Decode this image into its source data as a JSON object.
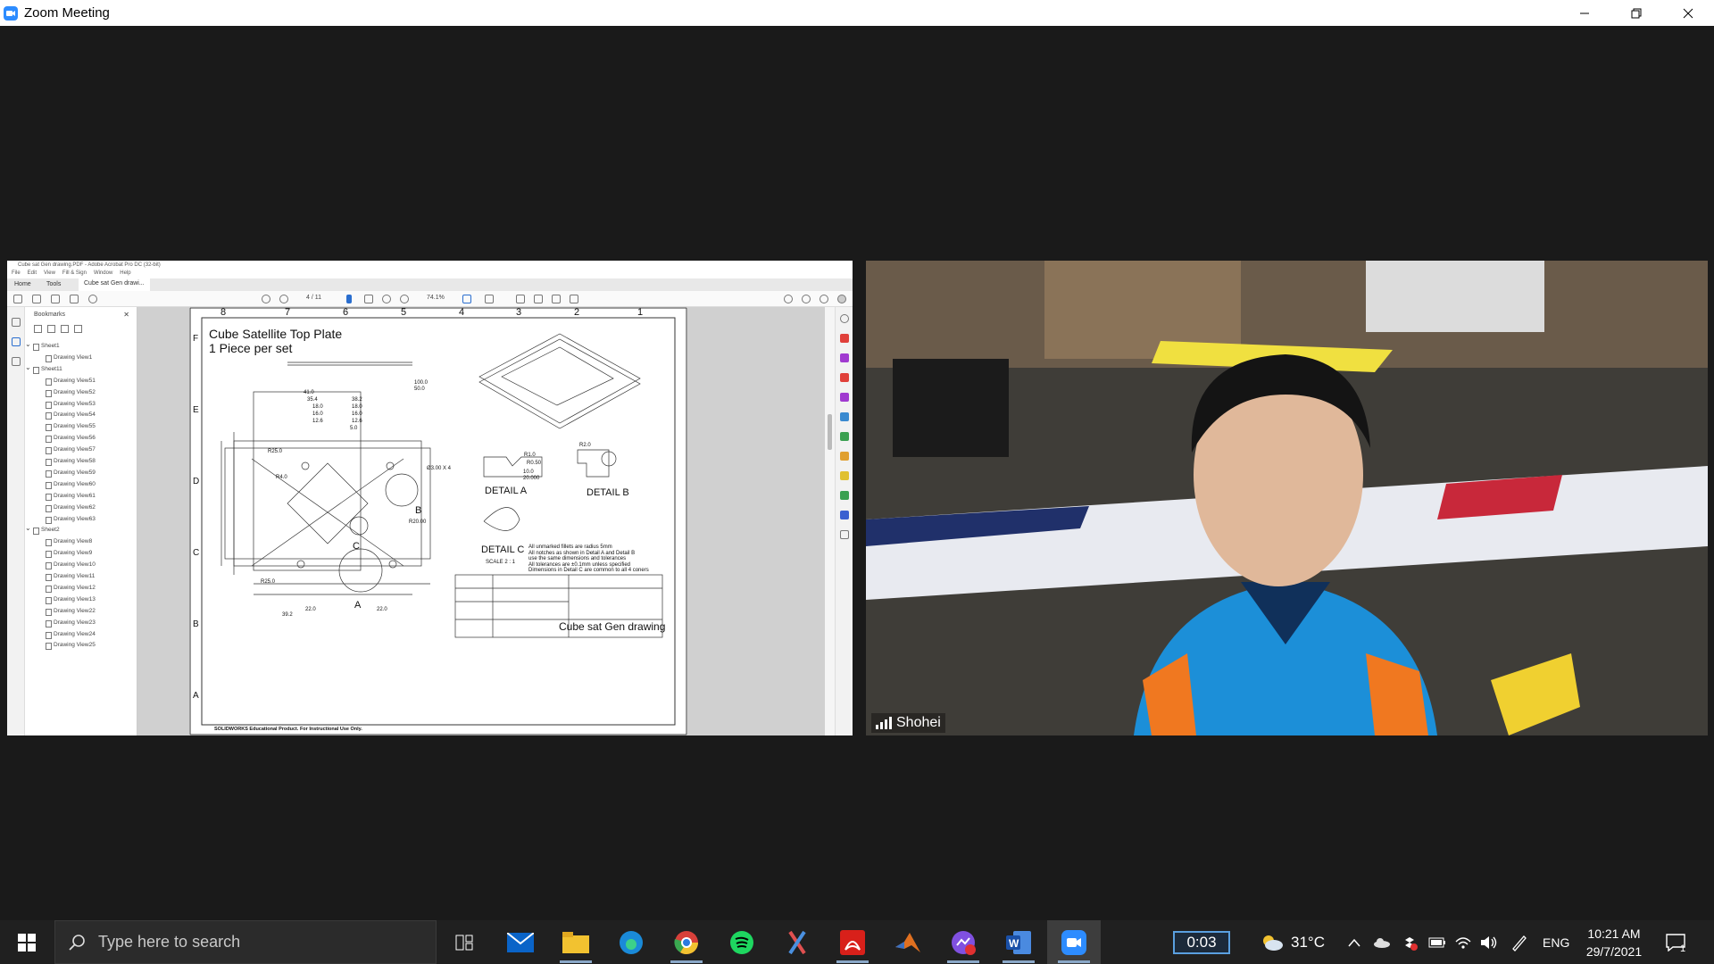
{
  "window": {
    "title": "Zoom Meeting"
  },
  "shared_screen": {
    "app_title": "Cube sat Gen drawing.PDF - Adobe Acrobat Pro DC (32-bit)",
    "menu": [
      "File",
      "Edit",
      "View",
      "Fill & Sign",
      "Window",
      "Help"
    ],
    "tabs": [
      "Home",
      "Tools",
      "Cube sat Gen drawi..."
    ],
    "page_indicator": "4 / 11",
    "zoom_level": "74.1%",
    "bookmarks_title": "Bookmarks",
    "bookmarks": [
      "Sheet1",
      "Drawing View1",
      "Sheet11",
      "Drawing View51",
      "Drawing View52",
      "Drawing View53",
      "Drawing View54",
      "Drawing View55",
      "Drawing View56",
      "Drawing View57",
      "Drawing View58",
      "Drawing View59",
      "Drawing View60",
      "Drawing View61",
      "Drawing View62",
      "Drawing View63",
      "Sheet2",
      "Drawing View8",
      "Drawing View9",
      "Drawing View10",
      "Drawing View11",
      "Drawing View12",
      "Drawing View13",
      "Drawing View22",
      "Drawing View23",
      "Drawing View24",
      "Drawing View25"
    ],
    "drawing": {
      "title": "Cube Satellite Top Plate",
      "subtitle": "1 Piece per set",
      "col_labels": [
        "8",
        "7",
        "6",
        "5",
        "4",
        "3",
        "2",
        "1"
      ],
      "row_labels": [
        "F",
        "E",
        "D",
        "C",
        "B",
        "A"
      ],
      "detail_a": "DETAIL A",
      "detail_b": "DETAIL B",
      "detail_c": "DETAIL C",
      "scale": "SCALE 2 : 1",
      "label_a": "A",
      "label_b": "B",
      "label_c": "C",
      "notes": [
        "All unmarked fillets are radius 5mm",
        "All notches as shown in Detail A and Detail B",
        "use the same dimensions and tolerances",
        "All tolerances are ±0.1mm unless specified",
        "Dimensions in Detail C are common to all 4 coners"
      ],
      "title_block_name": "Cube sat Gen drawing",
      "footer": "SOLIDWORKS Educational Product. For Instructional Use Only.",
      "dims": [
        "100.0",
        "50.0",
        "41.0",
        "35.4",
        "18.0",
        "16.0",
        "12.6",
        "38.2",
        "18.0",
        "16.0",
        "12.6",
        "5.0",
        "R25.0",
        "R4.0",
        "Ø3.00 X 4",
        "R20.00",
        "R25.0",
        "39.2",
        "22.0",
        "22.0",
        "R1.0",
        "R0.50",
        "10.0",
        "20.000",
        "R2.0"
      ]
    }
  },
  "participant": {
    "name": "Shohei"
  },
  "taskbar": {
    "search_placeholder": "Type here to search",
    "timer": "0:03",
    "weather": "31°C",
    "language": "ENG",
    "time": "10:21 AM",
    "date": "29/7/2021",
    "notification_count": "1",
    "apps": [
      "task-view",
      "mail",
      "file-explorer",
      "edge",
      "chrome",
      "spotify",
      "snip",
      "acrobat",
      "matlab",
      "messenger",
      "word",
      "zoom"
    ]
  }
}
